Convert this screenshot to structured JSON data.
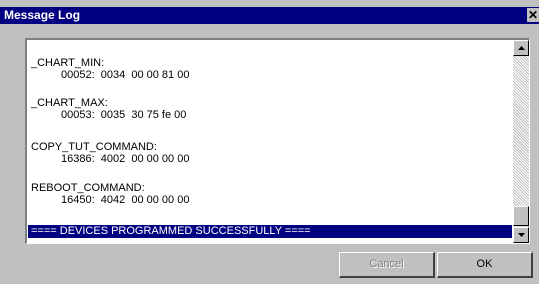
{
  "window": {
    "title": "Message Log",
    "close_glyph": "✕"
  },
  "log": {
    "entries": [
      {
        "name": "_CHART_MIN:",
        "value": "00052:  0034  00 00 81 00"
      },
      {
        "name": "_CHART_MAX:",
        "value": "00053:  0035  30 75 fe 00"
      },
      {
        "name": "COPY_TUT_COMMAND:",
        "value": "16386:  4002  00 00 00 00"
      },
      {
        "name": "REBOOT_COMMAND:",
        "value": "16450:  4042  00 00 00 00"
      }
    ],
    "status_line": "==== DEVICES PROGRAMMED SUCCESSFULLY ===="
  },
  "scrollbar": {
    "up_icon": "arrow-up-icon",
    "down_icon": "arrow-down-icon",
    "position_fraction": 0.95
  },
  "buttons": {
    "cancel_label": "Cancel",
    "ok_label": "OK"
  },
  "colors": {
    "titlebar": "#000080",
    "selection": "#000080",
    "face": "#c0c0c0"
  }
}
